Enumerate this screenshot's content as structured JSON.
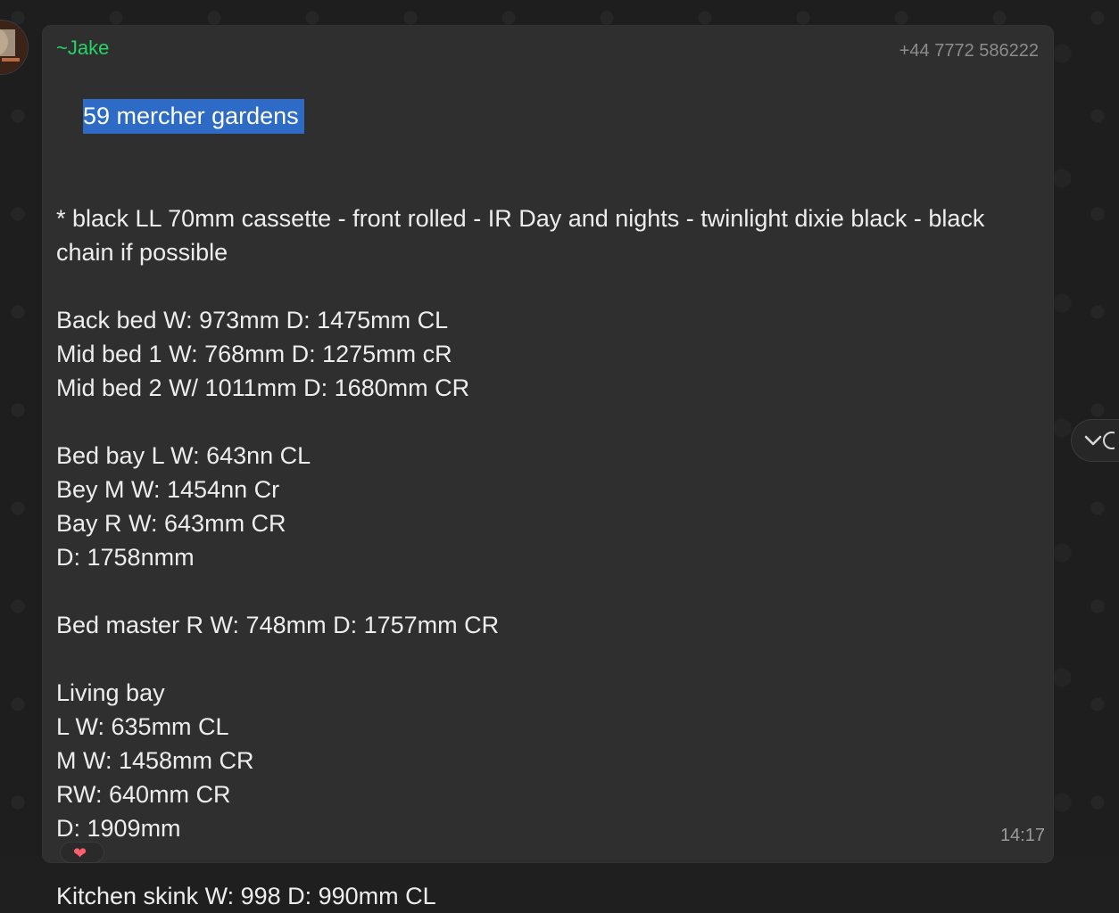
{
  "chat": {
    "sender": "~Jake",
    "phone": "+44 7772 586222",
    "time": "14:17",
    "selected_line": "59 mercher gardens",
    "lines": [
      "",
      "* black LL 70mm cassette - front rolled - IR Day and nights - twinlight dixie black - black chain if possible",
      "",
      "Back bed W: 973mm D: 1475mm CL",
      "Mid bed 1 W: 768mm D: 1275mm cR",
      "Mid bed 2 W/ 1011mm D: 1680mm CR",
      "",
      "Bed bay L W: 643nn CL",
      "Bey M W: 1454nn Cr",
      "Bay R W: 643mm CR",
      "D: 1758nmm",
      "",
      "Bed master R W: 748mm D: 1757mm CR",
      "",
      "Living bay",
      "L W: 635mm CL",
      "M W: 1458mm CR",
      "RW: 640mm CR",
      "D: 1909mm",
      "",
      "Kitchen skink W: 998 D: 990mm CL"
    ]
  },
  "colors": {
    "sender": "#25d366",
    "selection": "#2e6bc6",
    "bubble": "#2f2f2f"
  },
  "icons": {
    "scroll": "chevron-down-icon",
    "reaction": "heart-icon"
  },
  "reaction": {
    "emoji": "❤"
  }
}
